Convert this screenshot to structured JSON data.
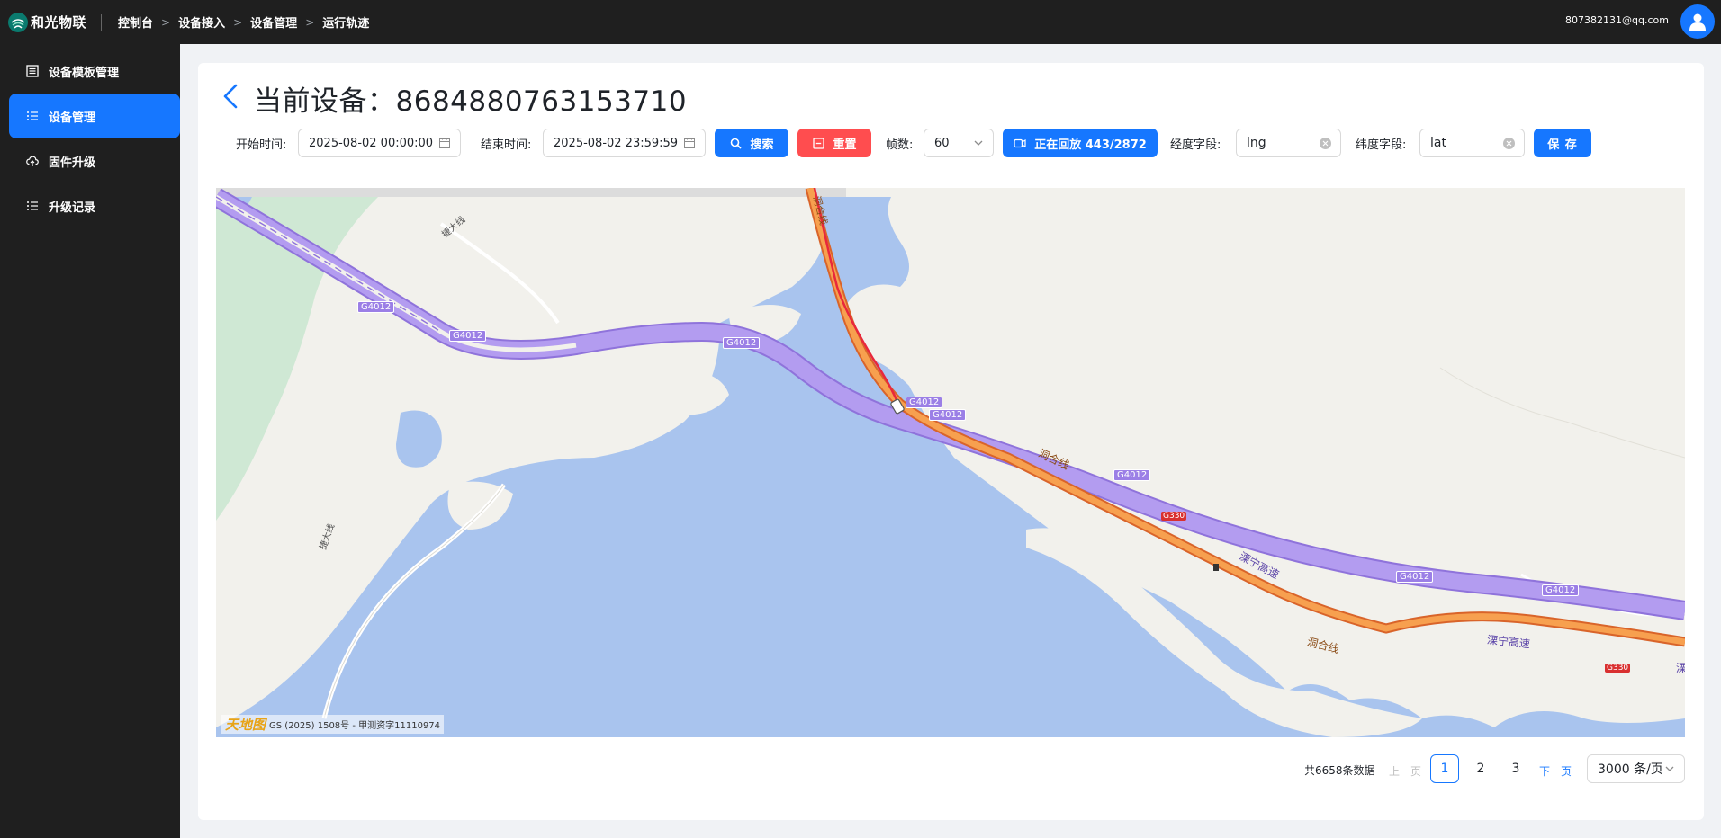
{
  "header": {
    "brand": "和光物联",
    "breadcrumb": [
      "控制台",
      "设备接入",
      "设备管理",
      "运行轨迹"
    ],
    "user_email": "807382131@qq.com"
  },
  "sidebar": {
    "items": [
      {
        "label": "设备模板管理",
        "icon": "template-icon",
        "active": false
      },
      {
        "label": "设备管理",
        "icon": "list-icon",
        "active": true
      },
      {
        "label": "固件升级",
        "icon": "cloud-upload-icon",
        "active": false
      },
      {
        "label": "升级记录",
        "icon": "list-icon",
        "active": false
      }
    ]
  },
  "page": {
    "title": "当前设备：8684880763153710"
  },
  "toolbar": {
    "start_label": "开始时间:",
    "start_value": "2025-08-02 00:00:00",
    "end_label": "结束时间:",
    "end_value": "2025-08-02 23:59:59",
    "search_label": "搜索",
    "reset_label": "重置",
    "fps_label": "帧数:",
    "fps_value": "60",
    "playback_label": "正在回放 443/2872",
    "lng_label": "经度字段:",
    "lng_value": "lng",
    "lat_label": "纬度字段:",
    "lat_value": "lat",
    "save_label": "保 存"
  },
  "map": {
    "road_labels": [
      "G4012",
      "G4012",
      "G4012",
      "G4012",
      "G4012",
      "G4012",
      "G4012",
      "G4012"
    ],
    "roads_cn": [
      "溧宁高速",
      "溧宁高速",
      "溧",
      "洞合线",
      "洞合线",
      "洞合线",
      "捷大线",
      "捷大线"
    ],
    "shield_g330": [
      "G330",
      "G330"
    ],
    "attribution": "GS (2025) 1508号 - 甲测资字11110974",
    "logo_text": "天地图",
    "colors": {
      "water": "#a9c4ee",
      "land": "#f2f1ec",
      "highway": "#b39cf0",
      "trunk": "#f07d3b",
      "track": "#e8283c"
    }
  },
  "pagination": {
    "total": "共6658条数据",
    "prev": "上一页",
    "pages": [
      "1",
      "2",
      "3"
    ],
    "current": "1",
    "next": "下一页",
    "page_size": "3000 条/页"
  }
}
